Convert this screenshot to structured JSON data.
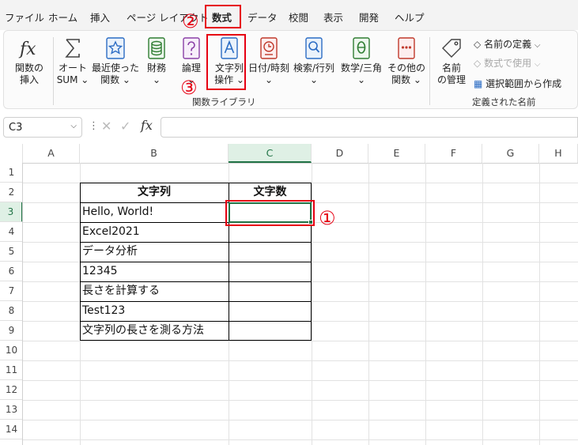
{
  "tabs": [
    "ファイル",
    "ホーム",
    "挿入",
    "ページ レイアウト",
    "数式",
    "データ",
    "校閲",
    "表示",
    "開発",
    "ヘルプ"
  ],
  "active_tab": "数式",
  "annotations": {
    "one": "①",
    "two": "②",
    "three": "③"
  },
  "ribbon": {
    "insert_function": [
      "関数の",
      "挿入"
    ],
    "autosum": [
      "オート",
      "SUM ⌄"
    ],
    "recent": [
      "最近使った",
      "関数 ⌄"
    ],
    "financial": [
      "財務",
      "⌄"
    ],
    "logical": [
      "論理",
      "⌄"
    ],
    "text": [
      "文字列",
      "操作 ⌄"
    ],
    "datetime": [
      "日付/時刻",
      "⌄"
    ],
    "lookup": [
      "検索/行列",
      "⌄"
    ],
    "math": [
      "数学/三角",
      "⌄"
    ],
    "more": [
      "その他の",
      "関数 ⌄"
    ],
    "library_label": "関数ライブラリ",
    "name_manager": [
      "名前",
      "の管理"
    ],
    "define_name": "名前の定義",
    "use_in_formula": "数式で使用",
    "create_from_selection": "選択範囲から作成",
    "defined_names_label": "定義された名前"
  },
  "formula_bar": {
    "name_box": "C3",
    "fx": "fx",
    "formula": ""
  },
  "columns": [
    "A",
    "B",
    "C",
    "D",
    "E",
    "F",
    "G",
    "H"
  ],
  "rows": [
    "1",
    "2",
    "3",
    "4",
    "5",
    "6",
    "7",
    "8",
    "9",
    "10",
    "11",
    "12",
    "13",
    "14"
  ],
  "table": {
    "header_b": "文字列",
    "header_c": "文字数",
    "values": [
      "Hello, World!",
      "Excel2021",
      "データ分析",
      "12345",
      "長さを計算する",
      "Test123",
      "文字列の長さを測る方法"
    ]
  },
  "colors": {
    "highlight": "#e60012",
    "accent": "#217346"
  }
}
